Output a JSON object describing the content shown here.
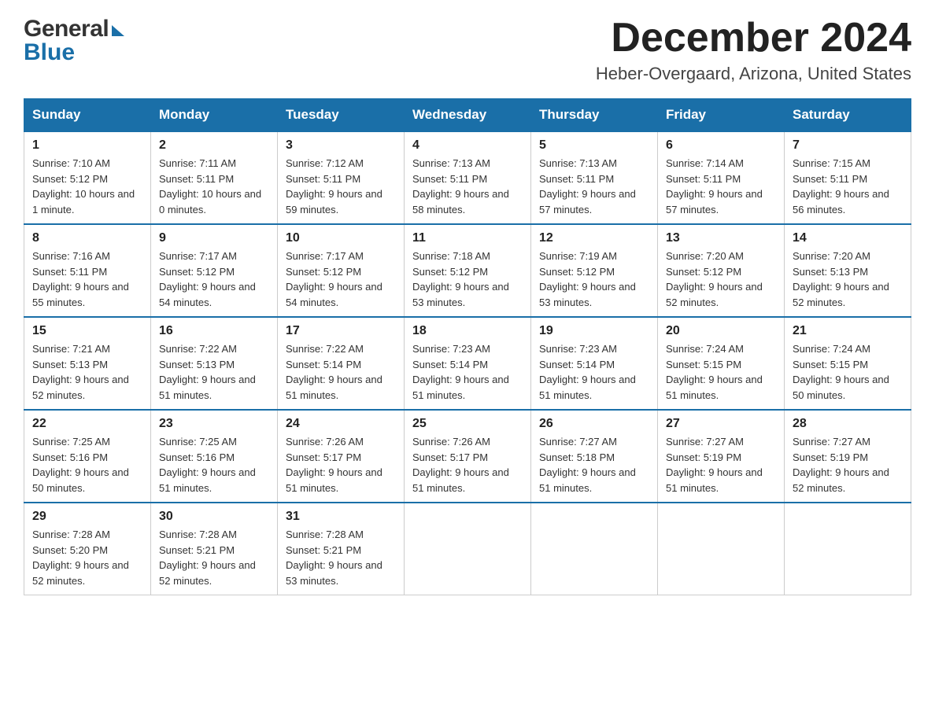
{
  "logo": {
    "general": "General",
    "blue": "Blue",
    "triangle": "▶"
  },
  "header": {
    "month": "December 2024",
    "location": "Heber-Overgaard, Arizona, United States"
  },
  "weekdays": [
    "Sunday",
    "Monday",
    "Tuesday",
    "Wednesday",
    "Thursday",
    "Friday",
    "Saturday"
  ],
  "weeks": [
    [
      {
        "day": "1",
        "sunrise": "7:10 AM",
        "sunset": "5:12 PM",
        "daylight": "10 hours and 1 minute."
      },
      {
        "day": "2",
        "sunrise": "7:11 AM",
        "sunset": "5:11 PM",
        "daylight": "10 hours and 0 minutes."
      },
      {
        "day": "3",
        "sunrise": "7:12 AM",
        "sunset": "5:11 PM",
        "daylight": "9 hours and 59 minutes."
      },
      {
        "day": "4",
        "sunrise": "7:13 AM",
        "sunset": "5:11 PM",
        "daylight": "9 hours and 58 minutes."
      },
      {
        "day": "5",
        "sunrise": "7:13 AM",
        "sunset": "5:11 PM",
        "daylight": "9 hours and 57 minutes."
      },
      {
        "day": "6",
        "sunrise": "7:14 AM",
        "sunset": "5:11 PM",
        "daylight": "9 hours and 57 minutes."
      },
      {
        "day": "7",
        "sunrise": "7:15 AM",
        "sunset": "5:11 PM",
        "daylight": "9 hours and 56 minutes."
      }
    ],
    [
      {
        "day": "8",
        "sunrise": "7:16 AM",
        "sunset": "5:11 PM",
        "daylight": "9 hours and 55 minutes."
      },
      {
        "day": "9",
        "sunrise": "7:17 AM",
        "sunset": "5:12 PM",
        "daylight": "9 hours and 54 minutes."
      },
      {
        "day": "10",
        "sunrise": "7:17 AM",
        "sunset": "5:12 PM",
        "daylight": "9 hours and 54 minutes."
      },
      {
        "day": "11",
        "sunrise": "7:18 AM",
        "sunset": "5:12 PM",
        "daylight": "9 hours and 53 minutes."
      },
      {
        "day": "12",
        "sunrise": "7:19 AM",
        "sunset": "5:12 PM",
        "daylight": "9 hours and 53 minutes."
      },
      {
        "day": "13",
        "sunrise": "7:20 AM",
        "sunset": "5:12 PM",
        "daylight": "9 hours and 52 minutes."
      },
      {
        "day": "14",
        "sunrise": "7:20 AM",
        "sunset": "5:13 PM",
        "daylight": "9 hours and 52 minutes."
      }
    ],
    [
      {
        "day": "15",
        "sunrise": "7:21 AM",
        "sunset": "5:13 PM",
        "daylight": "9 hours and 52 minutes."
      },
      {
        "day": "16",
        "sunrise": "7:22 AM",
        "sunset": "5:13 PM",
        "daylight": "9 hours and 51 minutes."
      },
      {
        "day": "17",
        "sunrise": "7:22 AM",
        "sunset": "5:14 PM",
        "daylight": "9 hours and 51 minutes."
      },
      {
        "day": "18",
        "sunrise": "7:23 AM",
        "sunset": "5:14 PM",
        "daylight": "9 hours and 51 minutes."
      },
      {
        "day": "19",
        "sunrise": "7:23 AM",
        "sunset": "5:14 PM",
        "daylight": "9 hours and 51 minutes."
      },
      {
        "day": "20",
        "sunrise": "7:24 AM",
        "sunset": "5:15 PM",
        "daylight": "9 hours and 51 minutes."
      },
      {
        "day": "21",
        "sunrise": "7:24 AM",
        "sunset": "5:15 PM",
        "daylight": "9 hours and 50 minutes."
      }
    ],
    [
      {
        "day": "22",
        "sunrise": "7:25 AM",
        "sunset": "5:16 PM",
        "daylight": "9 hours and 50 minutes."
      },
      {
        "day": "23",
        "sunrise": "7:25 AM",
        "sunset": "5:16 PM",
        "daylight": "9 hours and 51 minutes."
      },
      {
        "day": "24",
        "sunrise": "7:26 AM",
        "sunset": "5:17 PM",
        "daylight": "9 hours and 51 minutes."
      },
      {
        "day": "25",
        "sunrise": "7:26 AM",
        "sunset": "5:17 PM",
        "daylight": "9 hours and 51 minutes."
      },
      {
        "day": "26",
        "sunrise": "7:27 AM",
        "sunset": "5:18 PM",
        "daylight": "9 hours and 51 minutes."
      },
      {
        "day": "27",
        "sunrise": "7:27 AM",
        "sunset": "5:19 PM",
        "daylight": "9 hours and 51 minutes."
      },
      {
        "day": "28",
        "sunrise": "7:27 AM",
        "sunset": "5:19 PM",
        "daylight": "9 hours and 52 minutes."
      }
    ],
    [
      {
        "day": "29",
        "sunrise": "7:28 AM",
        "sunset": "5:20 PM",
        "daylight": "9 hours and 52 minutes."
      },
      {
        "day": "30",
        "sunrise": "7:28 AM",
        "sunset": "5:21 PM",
        "daylight": "9 hours and 52 minutes."
      },
      {
        "day": "31",
        "sunrise": "7:28 AM",
        "sunset": "5:21 PM",
        "daylight": "9 hours and 53 minutes."
      },
      null,
      null,
      null,
      null
    ]
  ],
  "labels": {
    "sunrise": "Sunrise:",
    "sunset": "Sunset:",
    "daylight": "Daylight:"
  }
}
